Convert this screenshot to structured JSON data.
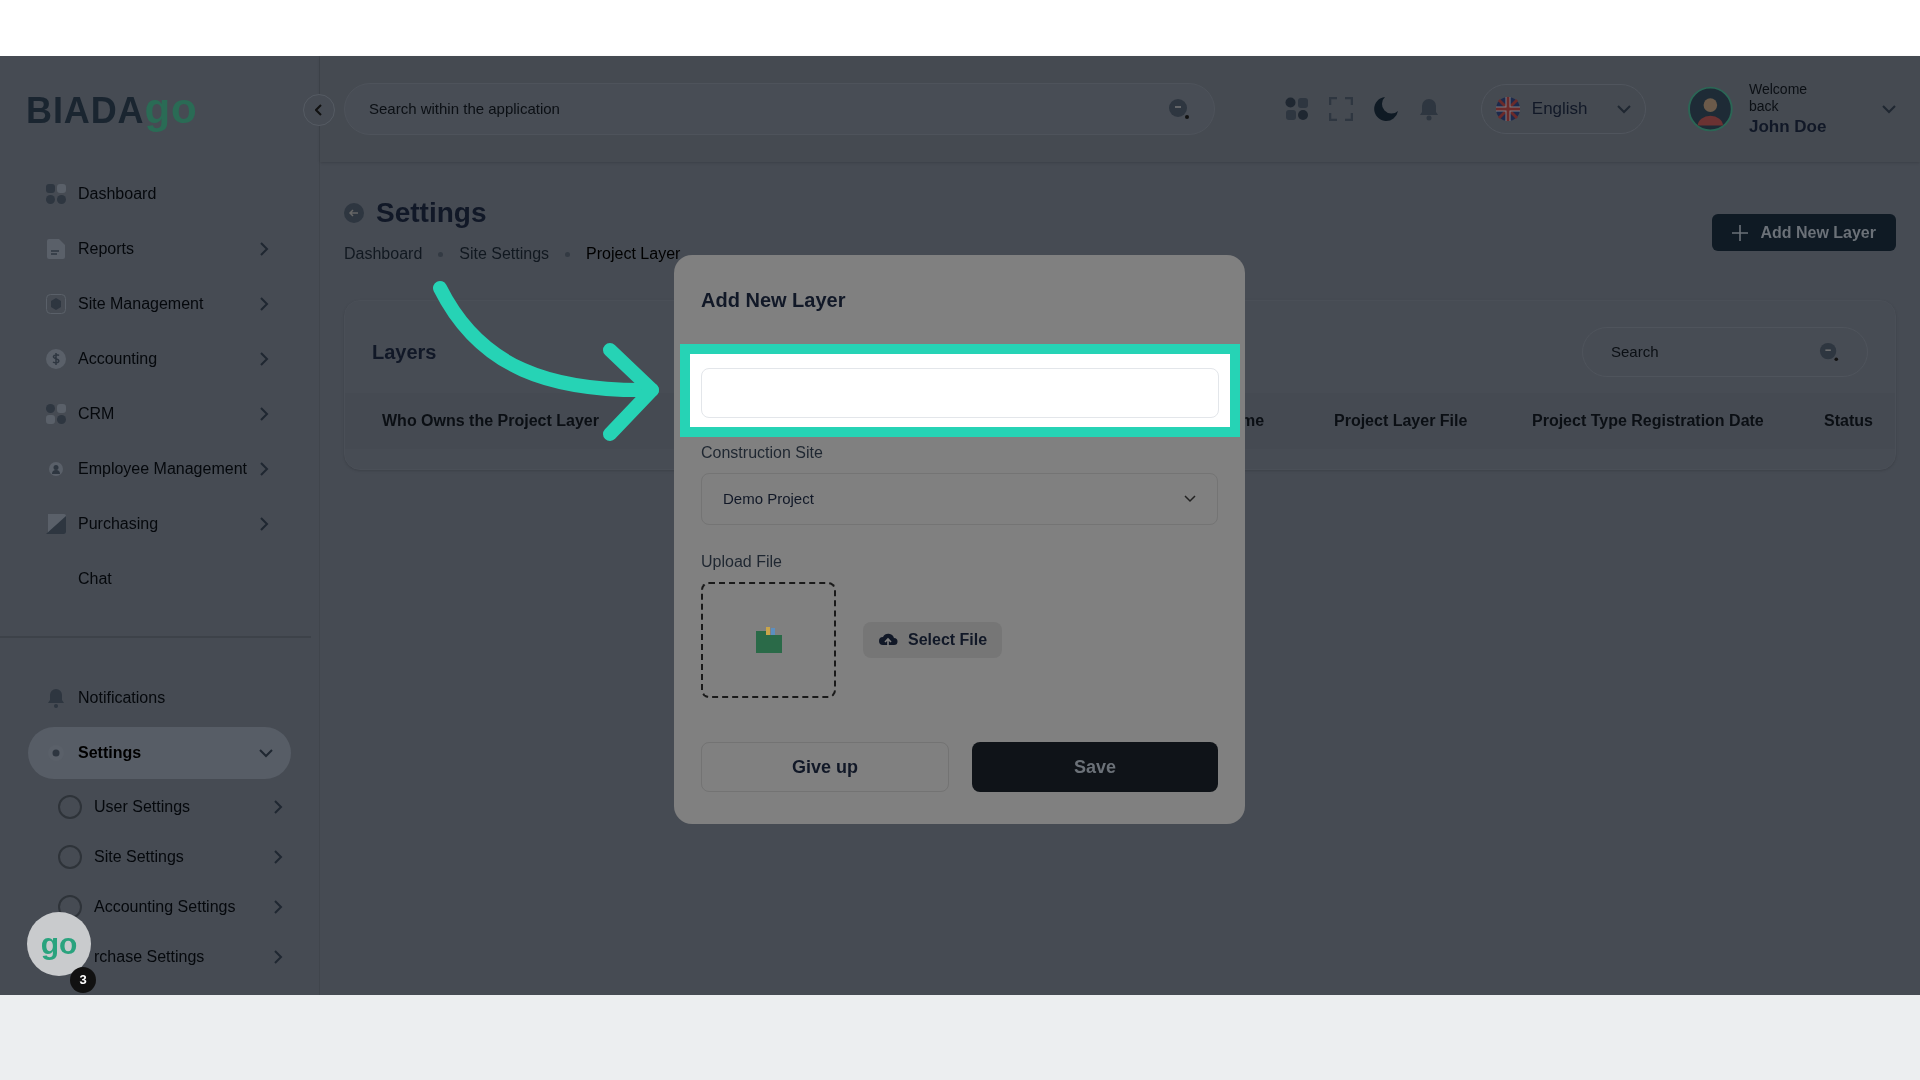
{
  "logo": {
    "text": "BIADA",
    "accent": "go"
  },
  "sidebar": {
    "items": [
      {
        "label": "Dashboard",
        "has_submenu": false,
        "selected": false
      },
      {
        "label": "Reports",
        "has_submenu": true,
        "selected": false
      },
      {
        "label": "Site Management",
        "has_submenu": true,
        "selected": false
      },
      {
        "label": "Accounting",
        "has_submenu": true,
        "selected": false
      },
      {
        "label": "CRM",
        "has_submenu": true,
        "selected": false
      },
      {
        "label": "Employee Management",
        "has_submenu": true,
        "selected": false
      },
      {
        "label": "Purchasing",
        "has_submenu": true,
        "selected": false
      },
      {
        "label": "Chat",
        "has_submenu": false,
        "selected": false
      }
    ],
    "bottom_items": [
      {
        "label": "Notifications",
        "selected": false
      },
      {
        "label": "Settings",
        "selected": true,
        "expanded": true,
        "children": [
          {
            "label": "User Settings",
            "selected": false
          },
          {
            "label": "Site Settings",
            "selected": false
          },
          {
            "label": "Accounting Settings",
            "selected": false
          },
          {
            "label": "rchase Settings",
            "selected": false
          }
        ]
      }
    ]
  },
  "header": {
    "search_placeholder": "Search within the application",
    "language": "English",
    "welcome": "Welcome back",
    "user": "John Doe"
  },
  "page": {
    "title": "Settings",
    "breadcrumbs": [
      "Dashboard",
      "Site Settings",
      "Project Layer"
    ],
    "add_button": "Add New Layer"
  },
  "card": {
    "title": "Layers",
    "search_placeholder": "Search",
    "columns": [
      "Who Owns the Project Layer",
      "me",
      "Project Layer File",
      "Project Type Registration Date",
      "Status"
    ]
  },
  "modal": {
    "title": "Add New Layer",
    "construction_site": {
      "label": "Construction Site",
      "value": "Demo Project"
    },
    "upload": {
      "label": "Upload File",
      "button": "Select File"
    },
    "buttons": [
      {
        "label": "Give up",
        "kind": "secondary"
      },
      {
        "label": "Save",
        "kind": "primary"
      }
    ]
  },
  "chat_bubble": {
    "logo": "go",
    "badge": "3"
  }
}
